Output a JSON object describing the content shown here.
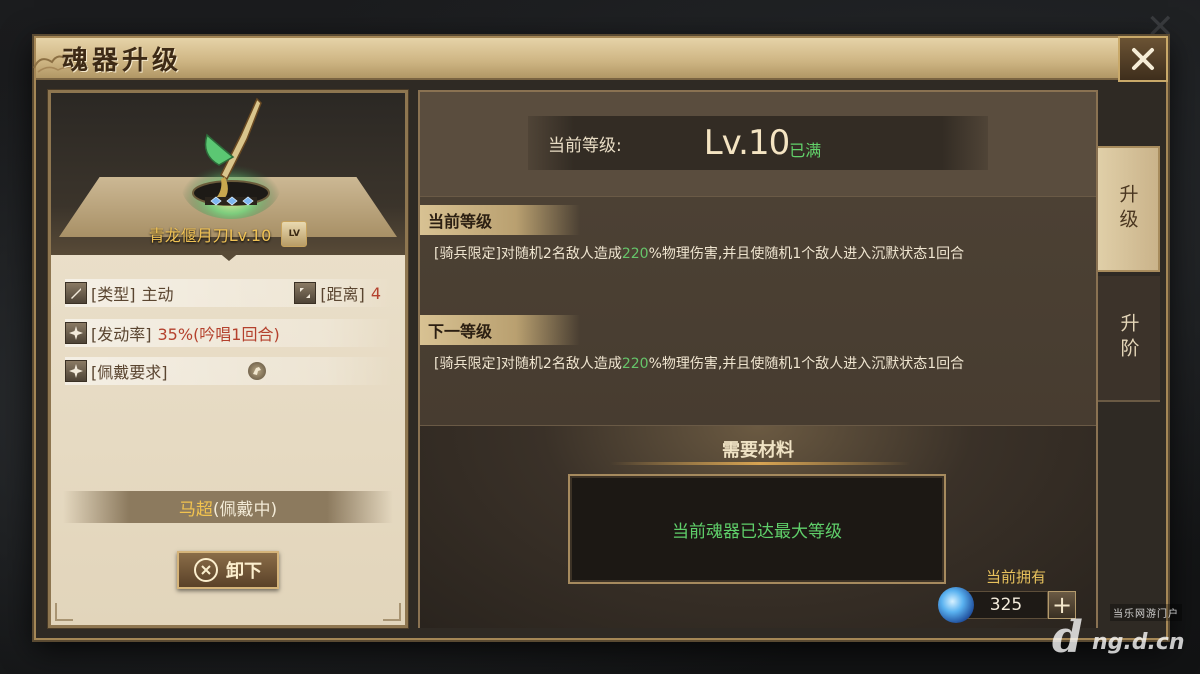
{
  "dialog": {
    "title": "魂器升级"
  },
  "weapon": {
    "name": "青龙偃月刀Lv.10",
    "lv_icon_text": "LV",
    "stats": {
      "type_label": "[类型]",
      "type_value": "主动",
      "range_label": "[距离]",
      "range_value": "4",
      "trigger_label": "[发动率]",
      "trigger_value": "35%(吟唱1回合)",
      "require_label": "[佩戴要求]"
    },
    "wearer_name": "马超",
    "wearer_status": "(佩戴中)",
    "unequip_label": "卸下"
  },
  "level": {
    "label": "当前等级:",
    "value": "Lv.10",
    "max_tag": "已满"
  },
  "current_level": {
    "heading": "当前等级",
    "desc_prefix": "[骑兵限定]对随机2名敌人造成",
    "desc_percent": "220",
    "desc_suffix": "%物理伤害,并且使随机1个敌人进入沉默状态1回合"
  },
  "next_level": {
    "heading": "下一等级",
    "desc_prefix": "[骑兵限定]对随机2名敌人造成",
    "desc_percent": "220",
    "desc_suffix": "%物理伤害,并且使随机1个敌人进入沉默状态1回合"
  },
  "materials": {
    "heading": "需要材料",
    "message": "当前魂器已达最大等级",
    "own_label": "当前拥有",
    "own_count": "325"
  },
  "tabs": [
    {
      "label": "升级",
      "active": true
    },
    {
      "label": "升阶",
      "active": false
    }
  ],
  "watermark": {
    "small": "当乐网游门户",
    "letter": "d",
    "domain": "ng.d.cn"
  },
  "colors": {
    "gold_text": "#f0c255",
    "green_highlight": "#62d16a",
    "red_value": "#b4412d",
    "frame": "#a58756"
  }
}
